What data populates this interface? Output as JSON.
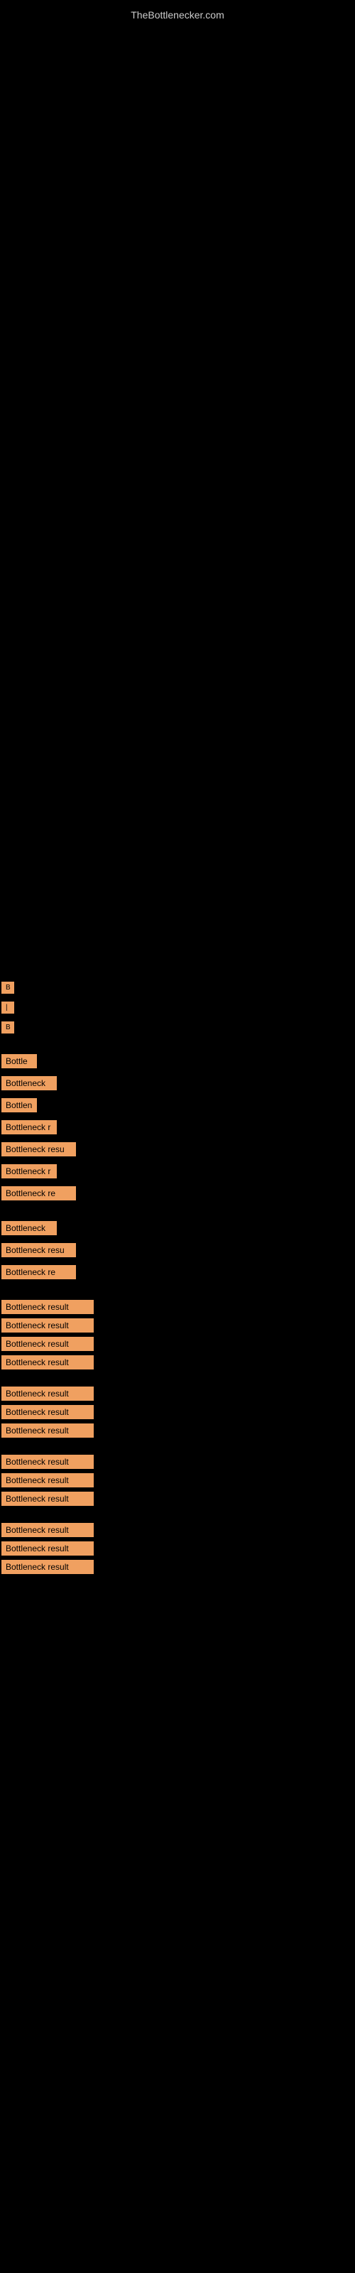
{
  "site": {
    "title": "TheBottlenecker.com"
  },
  "items": [
    {
      "label": "B",
      "size": "xs"
    },
    {
      "label": "|",
      "size": "xs"
    },
    {
      "label": "B",
      "size": "xs"
    },
    {
      "label": "Bottle",
      "size": "md"
    },
    {
      "label": "Bottleneck",
      "size": "lg"
    },
    {
      "label": "Bottlen",
      "size": "md"
    },
    {
      "label": "Bottleneck r",
      "size": "lg"
    },
    {
      "label": "Bottleneck resu",
      "size": "xl"
    },
    {
      "label": "Bottleneck r",
      "size": "lg"
    },
    {
      "label": "Bottleneck re",
      "size": "xl"
    },
    {
      "label": "Bottleneck",
      "size": "lg"
    },
    {
      "label": "Bottleneck resu",
      "size": "xl"
    },
    {
      "label": "Bottleneck re",
      "size": "xl"
    },
    {
      "label": "Bottleneck result",
      "size": "full"
    },
    {
      "label": "Bottleneck result",
      "size": "full"
    },
    {
      "label": "Bottleneck result",
      "size": "full"
    },
    {
      "label": "Bottleneck result",
      "size": "full"
    },
    {
      "label": "Bottleneck result",
      "size": "full"
    },
    {
      "label": "Bottleneck result",
      "size": "full"
    },
    {
      "label": "Bottleneck result",
      "size": "full"
    },
    {
      "label": "Bottleneck result",
      "size": "full"
    },
    {
      "label": "Bottleneck result",
      "size": "full"
    },
    {
      "label": "Bottleneck result",
      "size": "full"
    },
    {
      "label": "Bottleneck result",
      "size": "full"
    },
    {
      "label": "Bottleneck result",
      "size": "full"
    },
    {
      "label": "Bottleneck result",
      "size": "full"
    }
  ]
}
